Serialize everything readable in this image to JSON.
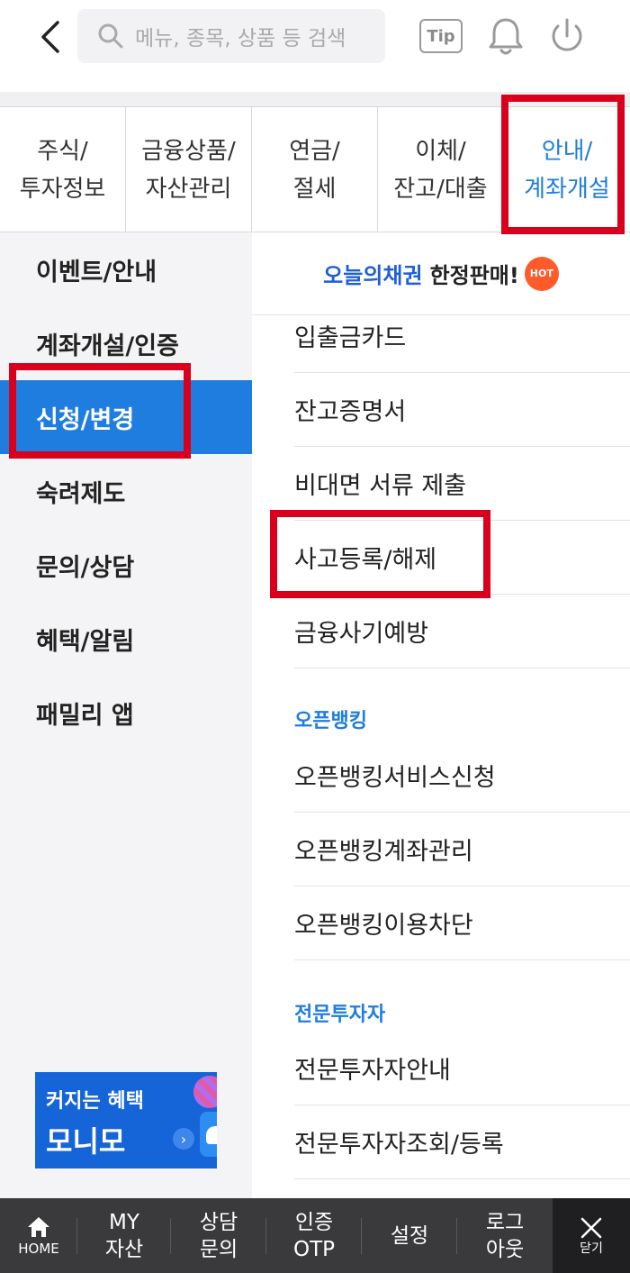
{
  "search": {
    "placeholder": "메뉴, 종목, 상품 등 검색"
  },
  "header": {
    "tip_label": "Tip"
  },
  "category_tabs": [
    {
      "label": "주식/\n투자정보",
      "active": false
    },
    {
      "label": "금융상품/\n자산관리",
      "active": false
    },
    {
      "label": "연금/\n절세",
      "active": false
    },
    {
      "label": "이체/\n잔고/대출",
      "active": false
    },
    {
      "label": "안내/\n계좌개설",
      "active": true
    }
  ],
  "sidebar": {
    "items": [
      {
        "label": "이벤트/안내",
        "active": false
      },
      {
        "label": "계좌개설/인증",
        "active": false
      },
      {
        "label": "신청/변경",
        "active": true
      },
      {
        "label": "숙려제도",
        "active": false
      },
      {
        "label": "문의/상담",
        "active": false
      },
      {
        "label": "혜택/알림",
        "active": false
      },
      {
        "label": "패밀리 앱",
        "active": false
      }
    ],
    "promo": {
      "line1": "커지는 혜택",
      "line2": "모니모"
    }
  },
  "content": {
    "banner": {
      "brand": "오늘의채권",
      "text": "한정판매!",
      "badge": "HOT"
    },
    "items": [
      "입출금카드",
      "잔고증명서",
      "비대면 서류 제출",
      "사고등록/해제",
      "금융사기예방"
    ],
    "sections": [
      {
        "title": "오픈뱅킹",
        "items": [
          "오픈뱅킹서비스신청",
          "오픈뱅킹계좌관리",
          "오픈뱅킹이용차단"
        ]
      },
      {
        "title": "전문투자자",
        "items": [
          "전문투자자안내",
          "전문투자자조회/등록"
        ]
      }
    ]
  },
  "bottom_nav": {
    "home": "HOME",
    "my": "MY\n자산",
    "consult": "상담\n문의",
    "otp": "인증\nOTP",
    "settings": "설정",
    "logout": "로그\n아웃",
    "close": "닫기"
  },
  "colors": {
    "accent": "#1f7de0",
    "highlight": "#d8001c",
    "nav_bg": "#3a3a3c"
  }
}
